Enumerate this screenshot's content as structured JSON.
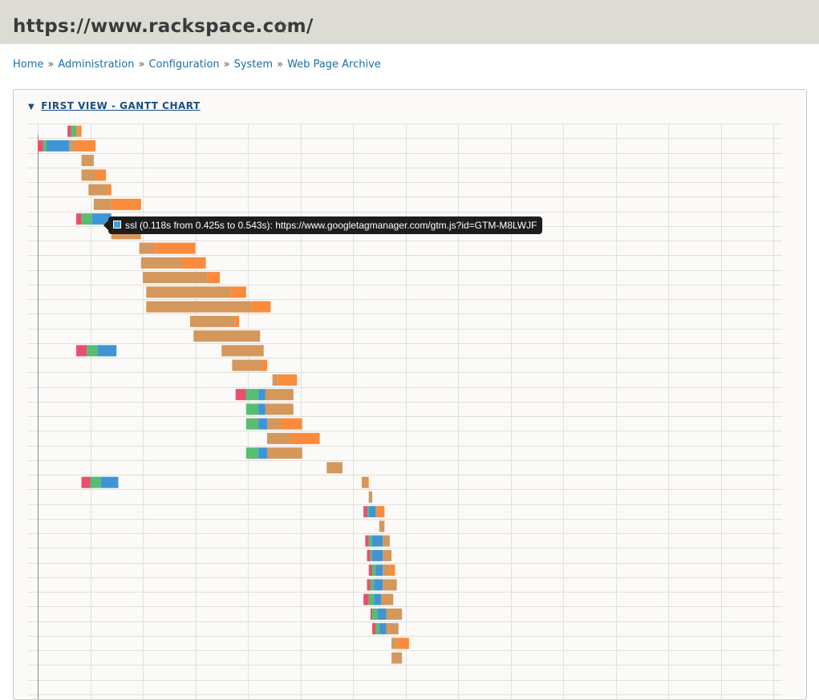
{
  "page": {
    "title": "https://www.rackspace.com/",
    "star_icon": "star-outline-icon"
  },
  "breadcrumb": {
    "items": [
      "Home",
      "Administration",
      "Configuration",
      "System",
      "Web Page Archive"
    ],
    "separator": "»"
  },
  "panel": {
    "legend": "FIRST VIEW - GANTT CHART",
    "toggle_icon": "triangle-down-icon"
  },
  "tooltip": {
    "text": "ssl (0.118s from 0.425s to 0.543s): https://www.googletagmanager.com/gtm.js?id=GTM-M8LWJF",
    "swatch_color": "#3fa0dc"
  },
  "colors": {
    "dns": "#e8506e",
    "connect": "#56bd72",
    "ssl": "#3f95d4",
    "ttfb": "#d4975c",
    "download": "#fa8b3c",
    "grid": "#e0e0dc",
    "axis": "#888888"
  },
  "chart_data": {
    "type": "gantt",
    "phases": [
      "dns",
      "connect",
      "ssl",
      "ttfb",
      "download"
    ],
    "rows": [
      {
        "segments": [
          [
            "dns",
            0.17,
            0.19
          ],
          [
            "connect",
            0.19,
            0.22
          ],
          [
            "ttfb",
            0.22,
            0.23
          ],
          [
            "download",
            0.23,
            0.25
          ]
        ]
      },
      {
        "segments": [
          [
            "dns",
            0.0,
            0.03
          ],
          [
            "connect",
            0.03,
            0.05
          ],
          [
            "ssl",
            0.05,
            0.18
          ],
          [
            "ttfb",
            0.18,
            0.22
          ],
          [
            "download",
            0.22,
            0.33
          ]
        ]
      },
      {
        "segments": [
          [
            "ttfb",
            0.25,
            0.32
          ]
        ]
      },
      {
        "segments": [
          [
            "ttfb",
            0.25,
            0.33
          ],
          [
            "download",
            0.33,
            0.39
          ]
        ]
      },
      {
        "segments": [
          [
            "ttfb",
            0.29,
            0.4
          ],
          [
            "download",
            0.4,
            0.42
          ]
        ]
      },
      {
        "segments": [
          [
            "ttfb",
            0.32,
            0.42
          ],
          [
            "download",
            0.42,
            0.59
          ]
        ]
      },
      {
        "segments": [
          [
            "dns",
            0.22,
            0.25
          ],
          [
            "connect",
            0.25,
            0.31
          ],
          [
            "ssl",
            0.31,
            0.42
          ]
        ]
      },
      {
        "segments": [
          [
            "ttfb",
            0.42,
            0.59
          ]
        ]
      },
      {
        "segments": [
          [
            "ttfb",
            0.58,
            0.67
          ],
          [
            "download",
            0.67,
            0.9
          ]
        ]
      },
      {
        "segments": [
          [
            "ttfb",
            0.59,
            0.82
          ],
          [
            "download",
            0.82,
            0.96
          ]
        ]
      },
      {
        "segments": [
          [
            "ttfb",
            0.6,
            0.97
          ],
          [
            "download",
            0.97,
            1.04
          ]
        ]
      },
      {
        "segments": [
          [
            "ttfb",
            0.62,
            1.1
          ],
          [
            "download",
            1.1,
            1.19
          ]
        ]
      },
      {
        "segments": [
          [
            "ttfb",
            0.62,
            1.22
          ],
          [
            "download",
            1.22,
            1.33
          ]
        ]
      },
      {
        "segments": [
          [
            "ttfb",
            0.87,
            1.13
          ],
          [
            "download",
            1.13,
            1.15
          ]
        ]
      },
      {
        "segments": [
          [
            "ttfb",
            0.89,
            1.27
          ]
        ]
      },
      {
        "segments": [
          [
            "dns",
            0.22,
            0.28
          ],
          [
            "connect",
            0.28,
            0.34
          ],
          [
            "ssl",
            0.34,
            0.45
          ],
          [
            "ttfb",
            1.05,
            1.29
          ]
        ]
      },
      {
        "segments": [
          [
            "ttfb",
            1.11,
            1.28
          ],
          [
            "download",
            1.28,
            1.31
          ]
        ]
      },
      {
        "segments": [
          [
            "ttfb",
            1.34,
            1.37
          ],
          [
            "download",
            1.37,
            1.48
          ]
        ]
      },
      {
        "segments": [
          [
            "dns",
            1.13,
            1.19
          ],
          [
            "connect",
            1.19,
            1.26
          ],
          [
            "ssl",
            1.26,
            1.3
          ],
          [
            "ttfb",
            1.3,
            1.46
          ]
        ]
      },
      {
        "segments": [
          [
            "connect",
            1.19,
            1.26
          ],
          [
            "ssl",
            1.26,
            1.3
          ],
          [
            "ttfb",
            1.3,
            1.46
          ]
        ]
      },
      {
        "segments": [
          [
            "connect",
            1.19,
            1.26
          ],
          [
            "ssl",
            1.26,
            1.31
          ],
          [
            "ttfb",
            1.31,
            1.39
          ],
          [
            "download",
            1.39,
            1.51
          ]
        ]
      },
      {
        "segments": [
          [
            "ttfb",
            1.31,
            1.44
          ],
          [
            "download",
            1.44,
            1.61
          ]
        ]
      },
      {
        "segments": [
          [
            "connect",
            1.19,
            1.26
          ],
          [
            "ssl",
            1.26,
            1.31
          ],
          [
            "ttfb",
            1.31,
            1.51
          ]
        ]
      },
      {
        "segments": [
          [
            "ttfb",
            1.65,
            1.74
          ]
        ]
      },
      {
        "segments": [
          [
            "dns",
            0.25,
            0.3
          ],
          [
            "connect",
            0.3,
            0.36
          ],
          [
            "ssl",
            0.36,
            0.46
          ],
          [
            "ttfb",
            1.85,
            1.88
          ],
          [
            "download",
            1.88,
            1.89
          ]
        ]
      },
      {
        "segments": [
          [
            "ttfb",
            1.89,
            1.91
          ]
        ]
      },
      {
        "segments": [
          [
            "dns",
            1.86,
            1.88
          ],
          [
            "connect",
            1.88,
            1.89
          ],
          [
            "ssl",
            1.89,
            1.93
          ],
          [
            "ttfb",
            1.93,
            1.94
          ],
          [
            "download",
            1.94,
            1.98
          ]
        ]
      },
      {
        "segments": [
          [
            "ttfb",
            1.95,
            1.98
          ]
        ]
      },
      {
        "segments": [
          [
            "dns",
            1.87,
            1.89
          ],
          [
            "connect",
            1.89,
            1.91
          ],
          [
            "ssl",
            1.91,
            1.97
          ],
          [
            "ttfb",
            1.97,
            2.01
          ]
        ]
      },
      {
        "segments": [
          [
            "dns",
            1.88,
            1.9
          ],
          [
            "connect",
            1.9,
            1.91
          ],
          [
            "ssl",
            1.91,
            1.97
          ],
          [
            "ttfb",
            1.97,
            2.02
          ]
        ]
      },
      {
        "segments": [
          [
            "dns",
            1.89,
            1.91
          ],
          [
            "connect",
            1.91,
            1.93
          ],
          [
            "ssl",
            1.93,
            1.97
          ],
          [
            "ttfb",
            1.97,
            2.01
          ],
          [
            "download",
            2.01,
            2.04
          ]
        ]
      },
      {
        "segments": [
          [
            "dns",
            1.88,
            1.9
          ],
          [
            "connect",
            1.9,
            1.92
          ],
          [
            "ssl",
            1.92,
            1.97
          ],
          [
            "ttfb",
            1.97,
            2.05
          ]
        ]
      },
      {
        "segments": [
          [
            "dns",
            1.86,
            1.89
          ],
          [
            "connect",
            1.89,
            1.92
          ],
          [
            "ssl",
            1.92,
            1.96
          ],
          [
            "ttfb",
            1.96,
            2.03
          ]
        ]
      },
      {
        "segments": [
          [
            "dns",
            1.9,
            1.91
          ],
          [
            "connect",
            1.91,
            1.94
          ],
          [
            "ssl",
            1.94,
            1.99
          ],
          [
            "ttfb",
            1.99,
            2.08
          ]
        ]
      },
      {
        "segments": [
          [
            "dns",
            1.91,
            1.93
          ],
          [
            "connect",
            1.93,
            1.95
          ],
          [
            "ssl",
            1.95,
            1.99
          ],
          [
            "ttfb",
            1.99,
            2.06
          ]
        ]
      },
      {
        "segments": [
          [
            "ttfb",
            2.02,
            2.05
          ],
          [
            "download",
            2.05,
            2.12
          ]
        ]
      },
      {
        "segments": [
          [
            "ttfb",
            2.02,
            2.08
          ]
        ]
      }
    ],
    "xlim": [
      0,
      4.25
    ],
    "grid": true,
    "grid_step": 0.3
  }
}
